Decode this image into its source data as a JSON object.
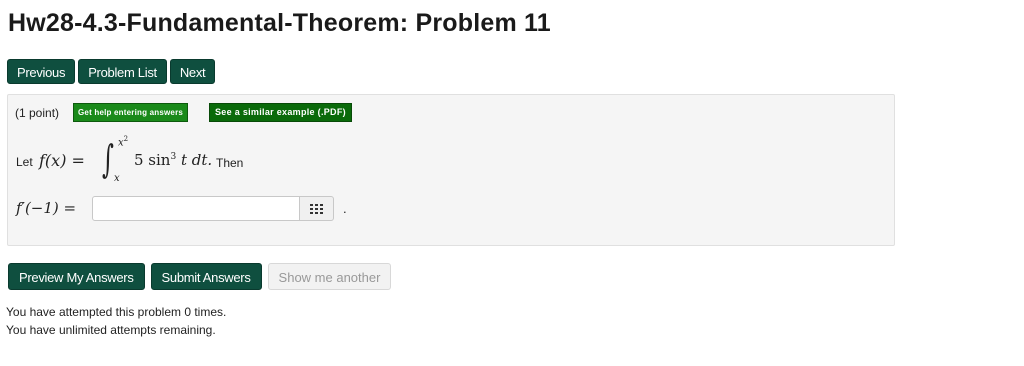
{
  "title": "Hw28-4.3-Fundamental-Theorem: Problem 11",
  "nav": {
    "previous": "Previous",
    "problem_list": "Problem List",
    "next": "Next"
  },
  "problem": {
    "points": "(1 point)",
    "help_answers": "Get help entering answers",
    "similar_example": "See a similar example (.PDF)",
    "let_label": "Let",
    "fx": "f(x) =",
    "upper_limit_base": "x",
    "upper_limit_exp": "2",
    "lower_limit": "x",
    "integrand_coef": "5 sin",
    "integrand_exp": "3",
    "integrand_rest": " t dt.",
    "then": "Then",
    "derivative_label": "f′(−1) =",
    "answer_value": "",
    "period": "."
  },
  "actions": {
    "preview": "Preview My Answers",
    "submit": "Submit Answers",
    "show_another": "Show me another"
  },
  "status": {
    "attempts": "You have attempted this problem 0 times.",
    "remaining": "You have unlimited attempts remaining."
  },
  "colors": {
    "primary_button": "#0f4f3f",
    "help_green": "#1a8a1a",
    "panel_bg": "#f5f5f5"
  }
}
